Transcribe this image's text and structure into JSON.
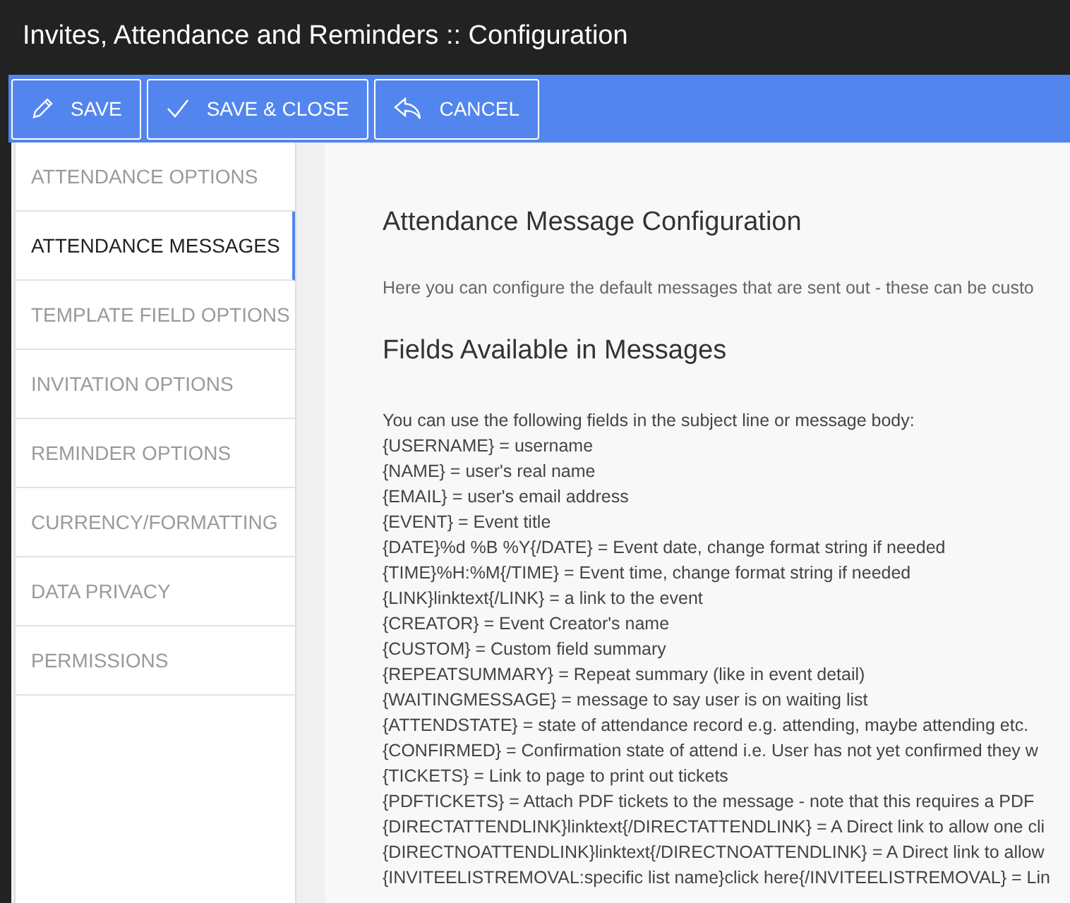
{
  "window": {
    "title": "Invites, Attendance and Reminders :: Configuration"
  },
  "toolbar": {
    "buttons": [
      {
        "label": "SAVE",
        "kind": "save"
      },
      {
        "label": "SAVE & CLOSE",
        "kind": "save-close"
      },
      {
        "label": "CANCEL",
        "kind": "cancel"
      }
    ]
  },
  "sidebar": {
    "items": [
      {
        "label": "ATTENDANCE OPTIONS",
        "selected": false
      },
      {
        "label": "ATTENDANCE MESSAGES",
        "selected": true
      },
      {
        "label": "TEMPLATE FIELD OPTIONS",
        "selected": false
      },
      {
        "label": "INVITATION OPTIONS",
        "selected": false
      },
      {
        "label": "REMINDER OPTIONS",
        "selected": false
      },
      {
        "label": "CURRENCY/FORMATTING",
        "selected": false
      },
      {
        "label": "DATA PRIVACY",
        "selected": false
      },
      {
        "label": "PERMISSIONS",
        "selected": false
      }
    ]
  },
  "content": {
    "heading": "Attendance Message Configuration",
    "intro": "Here you can configure the default messages that are sent out - these can be custo",
    "fields_heading": "Fields Available in Messages",
    "lines": [
      "You can use the following fields in the subject line or message body:",
      "{USERNAME} = username",
      "{NAME} = user's real name",
      "{EMAIL} = user's email address",
      "{EVENT} = Event title",
      "{DATE}%d %B %Y{/DATE} = Event date, change format string if needed",
      "{TIME}%H:%M{/TIME} = Event time, change format string if needed",
      "{LINK}linktext{/LINK} = a link to the event",
      "{CREATOR} = Event Creator's name",
      "{CUSTOM} = Custom field summary",
      "{REPEATSUMMARY} = Repeat summary (like in event detail)",
      "{WAITINGMESSAGE} = message to say user is on waiting list",
      "{ATTENDSTATE} = state of attendance record e.g. attending, maybe attending etc.",
      "{CONFIRMED} = Confirmation state of attend i.e. User has not yet confirmed they w",
      "{TICKETS} = Link to page to print out tickets",
      "{PDFTICKETS} = Attach PDF tickets to the message - note that this requires a PDF",
      "{DIRECTATTENDLINK}linktext{/DIRECTATTENDLINK} = A Direct link to allow one cli",
      "{DIRECTNOATTENDLINK}linktext{/DIRECTNOATTENDLINK} = A Direct link to allow",
      "{INVITEELISTREMOVAL:specific list name}click here{/INVITEELISTREMOVAL} = Lin"
    ]
  }
}
